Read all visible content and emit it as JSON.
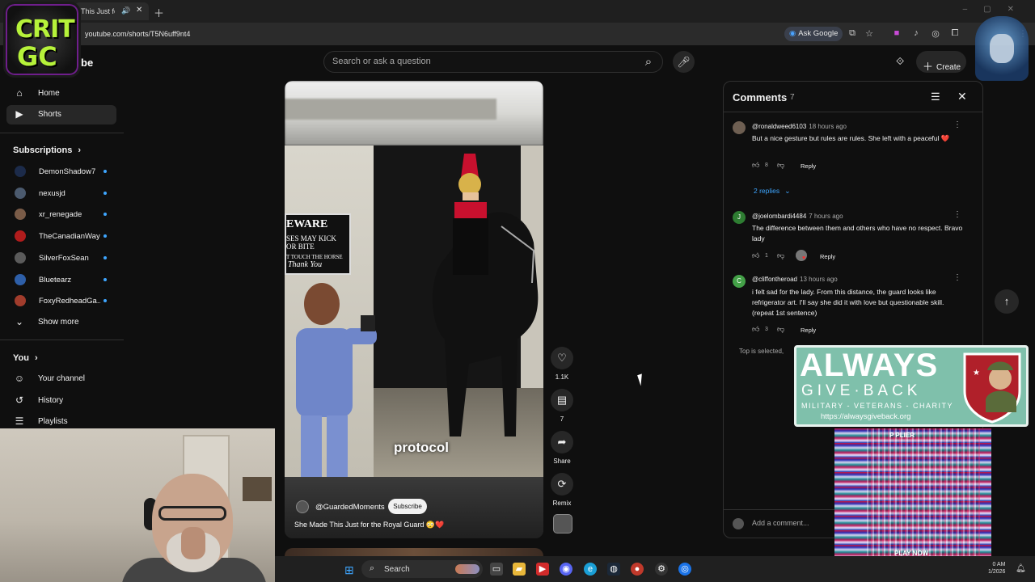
{
  "browser": {
    "tab_title": "This Just for",
    "url": "youtube.com/shorts/T5N6uff9nt4",
    "ask_google": "Ask Google"
  },
  "overlay_logo": {
    "line1": "CRIT",
    "line2": "GC"
  },
  "brand_fragment": "be",
  "header": {
    "search_placeholder": "Search or ask a question",
    "create_label": "Create"
  },
  "sidebar": {
    "home": "Home",
    "shorts": "Shorts",
    "subscriptions_header": "Subscriptions",
    "subscriptions": [
      {
        "name": "DemonShadow7",
        "color": "#1c2b4a"
      },
      {
        "name": "nexusjd",
        "color": "#4b5a6e"
      },
      {
        "name": "xr_renegade",
        "color": "#7a5c48"
      },
      {
        "name": "TheCanadianWay",
        "color": "#b01c1c"
      },
      {
        "name": "SilverFoxSean",
        "color": "#5b5b5b"
      },
      {
        "name": "Bluetearz",
        "color": "#2e5fa8"
      },
      {
        "name": "FoxyRedheadGa...",
        "color": "#a13c2c"
      }
    ],
    "show_more": "Show more",
    "you_header": "You",
    "your_channel": "Your channel",
    "history": "History",
    "playlists": "Playlists"
  },
  "short": {
    "sign_l1": "EWARE",
    "sign_l2a": "SES MAY KICK",
    "sign_l2b": "OR BITE",
    "sign_l3": "T TOUCH THE HORSE",
    "sign_l4": "Thank You",
    "caption": "protocol",
    "channel": "@GuardedMoments",
    "subscribe": "Subscribe",
    "title": "She Made This Just for the Royal Guard 😳❤️"
  },
  "actions": {
    "likes": "1.1K",
    "comments": "7",
    "share": "Share",
    "remix": "Remix"
  },
  "comments_panel": {
    "title": "Comments",
    "count": "7",
    "items": [
      {
        "user": "@ronaldweed6103",
        "ago": "18 hours ago",
        "text": "But a nice gesture but rules are rules. She left with a peaceful ❤️",
        "likes": "8",
        "reply": "Reply",
        "avatar_letter": "",
        "avatar_color": "#6e5f52"
      },
      {
        "user": "@joelombardi4484",
        "ago": "7 hours ago",
        "text": "The difference between them and others who have no respect. Bravo lady",
        "likes": "1",
        "reply": "Reply",
        "avatar_letter": "J",
        "avatar_color": "#2e7d32"
      },
      {
        "user": "@cliffontheroad",
        "ago": "13 hours ago",
        "text": "i felt sad for the lady. From this distance, the guard looks like refrigerator art. I'll say she did it with love but questionable skill. (repeat 1st sentence)",
        "likes": "3",
        "reply": "Reply",
        "avatar_letter": "C",
        "avatar_color": "#43a047"
      }
    ],
    "replies_toggle": "2 replies",
    "top_selected": "Top is selected,",
    "add_comment": "Add a comment..."
  },
  "ad": {
    "line1": "ALWAYS",
    "line2": "GIVE·BACK",
    "line3": "MILITARY - VETERANS - CHARITY",
    "url": "https://alwaysgiveback.org"
  },
  "glitch": {
    "t1": "P PLIER",
    "t2": "PLAY NOW"
  },
  "taskbar": {
    "search": "Search",
    "time": "0 AM",
    "date": "1/2026"
  },
  "icons": [
    "home-icon",
    "shorts-icon",
    "search-icon",
    "mic-icon",
    "like-icon",
    "comment-icon",
    "share-icon",
    "remix-icon",
    "sort-icon",
    "close-icon",
    "arrow-up-icon",
    "more-icon",
    "dislike-icon"
  ]
}
